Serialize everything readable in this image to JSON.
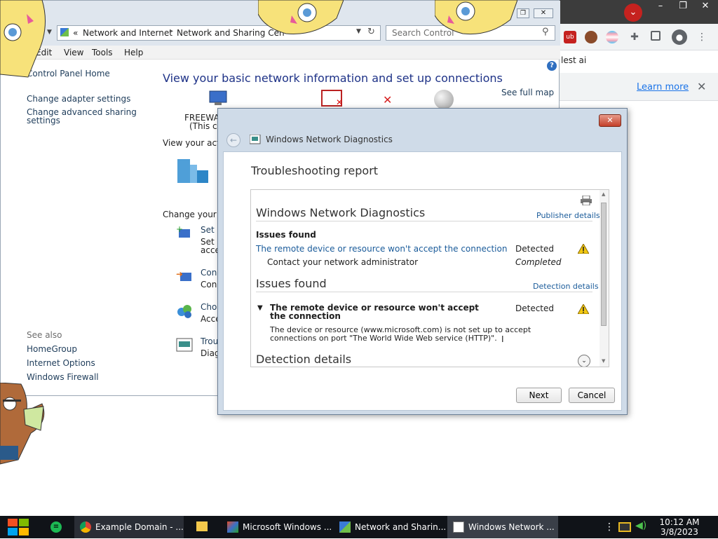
{
  "chrome": {
    "bookmark_text": "lest ai",
    "learn_more": "Learn more"
  },
  "control_panel": {
    "breadcrumb_sep": "«",
    "breadcrumb_1": "Network and Internet",
    "breadcrumb_2": "Network and Sharing Cen",
    "search_placeholder": "Search Control",
    "menu": [
      "Edit",
      "View",
      "Tools",
      "Help"
    ],
    "left_pane": {
      "home": "Control Panel Home",
      "link1": "Change adapter settings",
      "link2": "Change advanced sharing settings",
      "see_also": "See also",
      "see_also_items": [
        "HomeGroup",
        "Internet Options",
        "Windows Firewall"
      ]
    },
    "heading": "View your basic network information and set up connections",
    "see_full_map": "See full map",
    "computer_name": "FREEWA",
    "computer_sub": "(This co",
    "view_active": "View your activ",
    "change_network": "Change your n",
    "tasks": [
      {
        "title": "Set",
        "desc1": "Set",
        "desc2": "acce"
      },
      {
        "title": "Conn",
        "desc1": "Conn",
        "desc2": ""
      },
      {
        "title": "Choo",
        "desc1": "Acce",
        "desc2": ""
      },
      {
        "title": "Trou",
        "desc1": "Diag",
        "desc2": ""
      }
    ]
  },
  "dialog": {
    "title": "Windows Network Diagnostics",
    "heading": "Troubleshooting report",
    "report_title": "Windows Network Diagnostics",
    "publisher_details": "Publisher details",
    "issues_found_bold": "Issues found",
    "issue_link": "The remote device or resource won't accept the connection",
    "detected": "Detected",
    "contact": "Contact your network administrator",
    "completed": "Completed",
    "issues_found_section": "Issues found",
    "detection_details_link": "Detection details",
    "issue_expanded_title": "The remote device or resource won't accept the connection",
    "detected2": "Detected",
    "issue_desc": "The device or resource (www.microsoft.com) is not set up to accept connections on port \"The World Wide Web service (HTTP)\".",
    "detection_details_section": "Detection details",
    "next": "Next",
    "cancel": "Cancel"
  },
  "taskbar": {
    "items": [
      {
        "label": "Example Domain - ..."
      },
      {
        "label": "Microsoft Windows ..."
      },
      {
        "label": "Network and Sharin..."
      },
      {
        "label": "Windows Network ..."
      }
    ],
    "time": "10:12 AM",
    "date": "3/8/2023"
  }
}
